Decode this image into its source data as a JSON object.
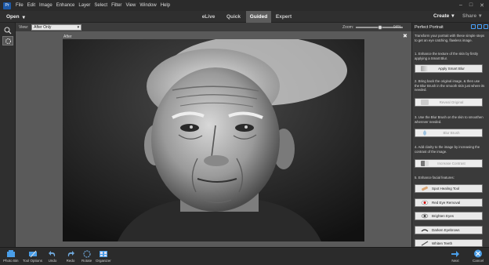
{
  "menu": {
    "app_logo": "Pr",
    "items": [
      "File",
      "Edit",
      "Image",
      "Enhance",
      "Layer",
      "Select",
      "Filter",
      "View",
      "Window",
      "Help"
    ]
  },
  "modebar": {
    "open_label": "Open",
    "modes": [
      "eLive",
      "Quick",
      "Guided",
      "Expert"
    ],
    "active_mode": "Guided",
    "create_label": "Create",
    "share_label": "Share"
  },
  "viewbar": {
    "view_label": "View:",
    "view_value": "After Only",
    "zoom_label": "Zoom:",
    "zoom_value": "94%",
    "zoom_level_fraction": 0.94
  },
  "canvas": {
    "label": "After",
    "close_glyph": "✖"
  },
  "panel": {
    "title": "Perfect Portrait",
    "intro": "Transform your portrait with these simple steps to get an eye catching, flawless image.",
    "steps": [
      {
        "text": "1. Enhance the texture of the skin by firstly applying a Smart Blur.",
        "button": "Apply Smart Blur",
        "enabled": true
      },
      {
        "text": "2. Bring back the original image, & then use the Blur Brush in the smooth skin just where its needed.",
        "button": "Reveal Original",
        "enabled": false
      },
      {
        "text": "3. Use the Blur Brush on the skin to smoothen wherever needed.",
        "button": "Blur Brush",
        "enabled": false
      },
      {
        "text": "4. Add clarity to the image by increasing the contrast of the image.",
        "button": "Increase Contrast",
        "enabled": false
      },
      {
        "text": "5. Enhance facial features:",
        "button": "Spot Healing Tool",
        "enabled": true
      }
    ],
    "extra_buttons": [
      "Red Eye Removal",
      "Brighten Eyes",
      "Darken Eyebrows",
      "Whiten Teeth"
    ]
  },
  "bottombar": {
    "photo_bin": "Photo Bin",
    "tool_options": "Tool Options",
    "undo": "Undo",
    "redo": "Redo",
    "rotate": "Rotate",
    "organizer": "Organizer",
    "next": "Next",
    "cancel": "Cancel"
  },
  "colors": {
    "accent": "#4aa3ff",
    "active_mode_bg": "#5c5c5c",
    "panel_bg": "#3a3a3a"
  }
}
